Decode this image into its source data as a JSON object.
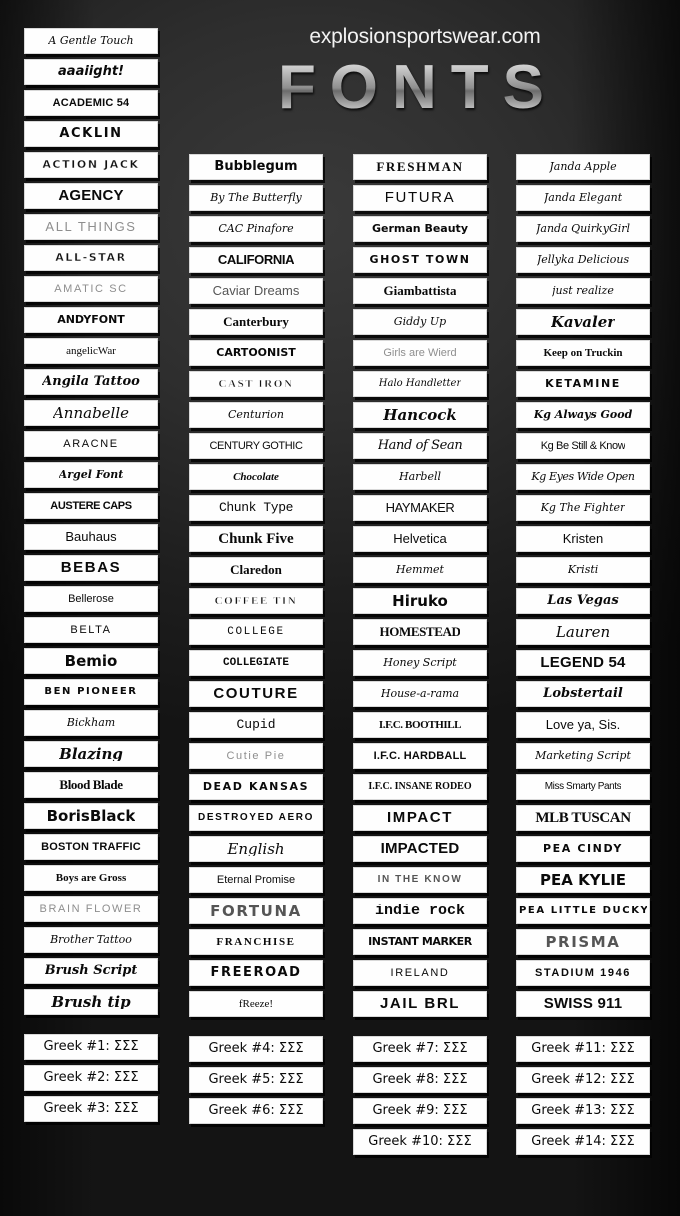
{
  "header": {
    "site_url": "explosionsportswear.com",
    "title": "FONTS"
  },
  "colors": {
    "background": "#1e1e1e",
    "chip_background": "#fefefe",
    "chip_text": "#0a0a0a",
    "title_gradient_light": "#e9e9e9",
    "title_gradient_dark": "#6b6b6b"
  },
  "columns": [
    {
      "id": "column-1",
      "items": [
        "A Gentle Touch",
        "aaaiight!",
        "ACADEMIC 54",
        "ACKLIN",
        "ACTION JACK",
        "AGENCY",
        "ALL THINGS",
        "ALL-STAR",
        "AMATIC SC",
        "ANDYFONT",
        "angelicWar",
        "Angila Tattoo",
        "Annabelle",
        "ARACNE",
        "Argel Font",
        "AUSTERE CAPS",
        "Bauhaus",
        "BEBAS",
        "Bellerose",
        "BELTA",
        "Bemio",
        "BEN PIONEER",
        "Bickham",
        "Blazing",
        "Blood Blade",
        "BorisBlack",
        "BOSTON TRAFFIC",
        "Boys are Gross",
        "BRAIN FLOWER",
        "Brother Tattoo",
        "Brush Script",
        "Brush tip"
      ],
      "greek": [
        "Greek #1: ΣΣΣ",
        "Greek #2: ΣΣΣ",
        "Greek #3: ΣΣΣ"
      ]
    },
    {
      "id": "column-2",
      "items": [
        "Bubblegum",
        "By The Butterfly",
        "CAC Pinafore",
        "CALIFORNIA",
        "Caviar Dreams",
        "Canterbury",
        "CARTOONIST",
        "CAST IRON",
        "Centurion",
        "CENTURY GOTHIC",
        "Chocolate",
        "Chunk Type",
        "Chunk Five",
        "Claredon",
        "COFFEE TIN",
        "COLLEGE",
        "COLLEGIATE",
        "COUTURE",
        "Cupid",
        "Cutie Pie",
        "DEAD KANSAS",
        "DESTROYED AERO",
        "English",
        "Eternal Promise",
        "FORTUNA",
        "FRANCHISE",
        "FREEROAD",
        "fReeze!"
      ],
      "greek": [
        "Greek #4: ΣΣΣ",
        "Greek #5: ΣΣΣ",
        "Greek #6: ΣΣΣ"
      ]
    },
    {
      "id": "column-3",
      "items": [
        "FRESHMAN",
        "FUTURA",
        "German Beauty",
        "GHOST TOWN",
        "Giambattista",
        "Giddy Up",
        "Girls are Wierd",
        "Halo Handletter",
        "Hancock",
        "Hand of Sean",
        "Harbell",
        "HAYMAKER",
        "Helvetica",
        "Hemmet",
        "Hiruko",
        "HOMESTEAD",
        "Honey Script",
        "House-a-rama",
        "I.F.C. BOOTHILL",
        "I.F.C. HARDBALL",
        "I.F.C. INSANE RODEO",
        "IMPACT",
        "IMPACTED",
        "IN THE KNOW",
        "indie rock",
        "INSTANT MARKER",
        "IRELAND",
        "JAIL BRL"
      ],
      "greek": [
        "Greek #7: ΣΣΣ",
        "Greek #8: ΣΣΣ",
        "Greek #9:  ΣΣΣ",
        "Greek #10: ΣΣΣ"
      ]
    },
    {
      "id": "column-4",
      "items": [
        "Janda Apple",
        "Janda Elegant",
        "Janda QuirkyGirl",
        "Jellyka Delicious",
        "just realize",
        "Kavaler",
        "Keep on Truckin",
        "KETAMINE",
        "Kg Always Good",
        "Kg Be Still & Know",
        "Kg Eyes Wide Open",
        "Kg The Fighter",
        "Kristen",
        "Kristi",
        "Las Vegas",
        "Lauren",
        "LEGEND 54",
        "Lobstertail",
        "Love ya, Sis.",
        "Marketing Script",
        "Miss Smarty Pants",
        "MLB TUSCAN",
        "PEA CINDY",
        "PEA KYLIE",
        "PEA LITTLE DUCKY",
        "PRISMA",
        "STADIUM 1946",
        "SWISS 911"
      ],
      "greek": [
        "Greek #11: ΣΣΣ",
        "Greek #12: ΣΣΣ",
        "Greek #13: ΣΣΣ",
        "Greek #14: ΣΣΣ"
      ]
    }
  ]
}
